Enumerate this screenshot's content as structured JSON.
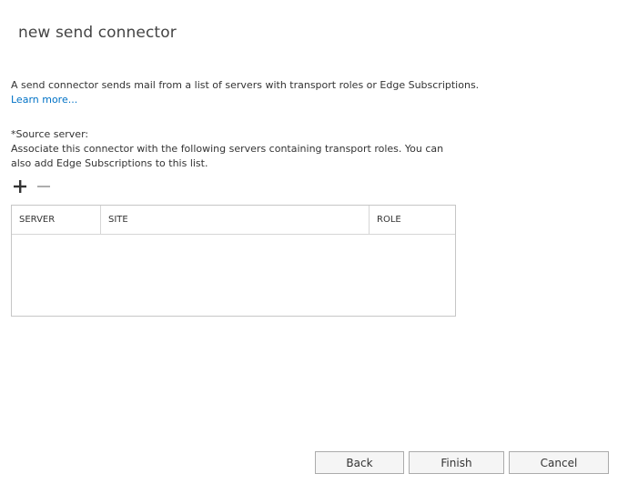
{
  "page": {
    "title": "new send connector"
  },
  "intro": {
    "text": "A send connector sends mail from a list of servers with transport roles or Edge Subscriptions.",
    "learn_more": "Learn more..."
  },
  "source": {
    "label": "*Source server:",
    "description": "Associate this connector with the following servers containing transport roles. You can also add Edge Subscriptions to this list."
  },
  "toolbar": {
    "add_icon": "plus-icon",
    "remove_icon": "minus-icon"
  },
  "table": {
    "columns": [
      "SERVER",
      "SITE",
      "ROLE"
    ],
    "rows": []
  },
  "buttons": {
    "back": "Back",
    "finish": "Finish",
    "cancel": "Cancel"
  },
  "colors": {
    "link": "#0072c6",
    "border": "#c6c6c6",
    "button_bg": "#f5f5f5"
  }
}
